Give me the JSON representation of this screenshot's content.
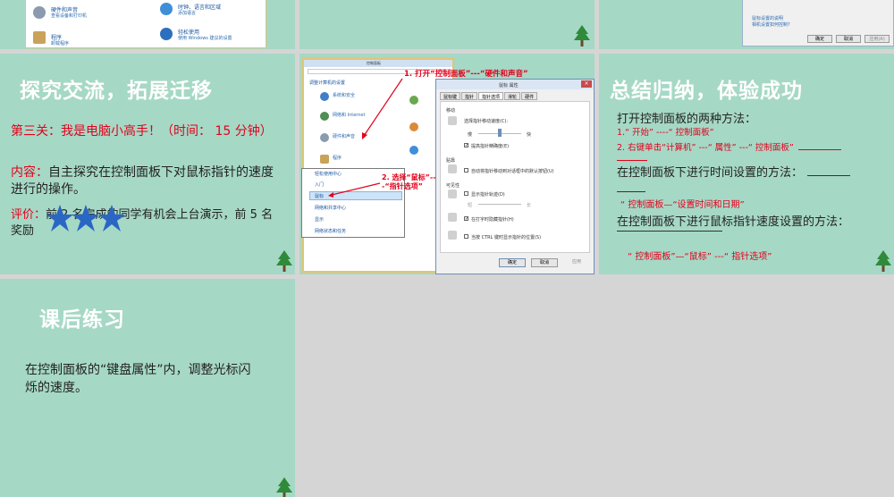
{
  "colors": {
    "slide_bg": "#a6d8c6",
    "accent_red": "#e3001b",
    "star_blue": "#2a66c4",
    "title_white": "#ffffff"
  },
  "slide1": {
    "items": [
      {
        "title": "硬件和声音",
        "sub": "查看设备和打印机"
      },
      {
        "title": "程序",
        "sub": "卸载程序"
      }
    ],
    "items_right": [
      {
        "title": "时钟、语言和区域",
        "sub": "添加语言"
      },
      {
        "title": "轻松使用",
        "sub": "使用 Windows 建议的设置"
      }
    ]
  },
  "slide2": {
    "dialog_links": [
      "鼠标设置的说明",
      "相机设置如何控制?"
    ],
    "buttons": [
      "确定",
      "取消",
      "应用(A)"
    ]
  },
  "slide3": {
    "title": "探究交流，拓展迁移",
    "level": "第三关：我是电脑小高手！（时间： 15 分钟）",
    "content_label": "内容：",
    "content_text": "自主探究在控制面板下对鼠标指针的速度进行的操作。",
    "eval_label": "评价：",
    "eval_text": "前 2 名完成的同学有机会上台演示，前 5 名奖励",
    "stars": 3
  },
  "slide4": {
    "annot1": "1. 打开“控制面板”---“硬件和声音”",
    "annot2": "2. 选择“鼠标”---“指针选项”",
    "window_title": "控制面板",
    "cp_heading": "调整计算机的设置",
    "cp_items": [
      "系统和安全",
      "网络和 Internet",
      "硬件和声音",
      "程序"
    ],
    "popup_items": [
      "轻松使用中心",
      "入门",
      "鼠标",
      "网络和共享中心",
      "显示",
      "网络状态和任务"
    ],
    "dialog_title": "鼠标 属性",
    "tabs": [
      "鼠标键",
      "指针",
      "指针选项",
      "滑轮",
      "硬件"
    ],
    "sec_motion": "移动",
    "speed_label": "选择指针移动速度(C):",
    "slow": "慢",
    "fast": "快",
    "precision": "提高指针精确度(E)",
    "sec_snap": "贴靠",
    "snap_opt": "自动将指针移动到对话框中的默认按钮(U)",
    "sec_vis": "可见性",
    "trail_opt": "显示指针轨迹(D)",
    "short": "短",
    "long": "长",
    "hide_opt": "在打字时隐藏指针(H)",
    "ctrl_opt": "当按 CTRL 键时显示指针的位置(S)",
    "ok": "确定",
    "cancel": "取消",
    "apply": "应用"
  },
  "slide5": {
    "title": "总结归纳，体验成功",
    "l1": "打开控制面板的两种方法：",
    "m1": "1.“ 开始” ----“ 控制面板”",
    "m2": "2. 右键单击“计算机” ---“ 属性” ---“ 控制面板”",
    "l2": "在控制面板下进行时间设置的方法：",
    "a2": "“ 控制面板—“设置时间和日期”",
    "l3": "在控制面板下进行鼠标指针速度设置的方法：",
    "a3": "“ 控制面板”—“鼠标” ---“ 指针选项”"
  },
  "slide6": {
    "title": "课后练习",
    "text": "在控制面板的“键盘属性”内，调整光标闪烁的速度。"
  }
}
